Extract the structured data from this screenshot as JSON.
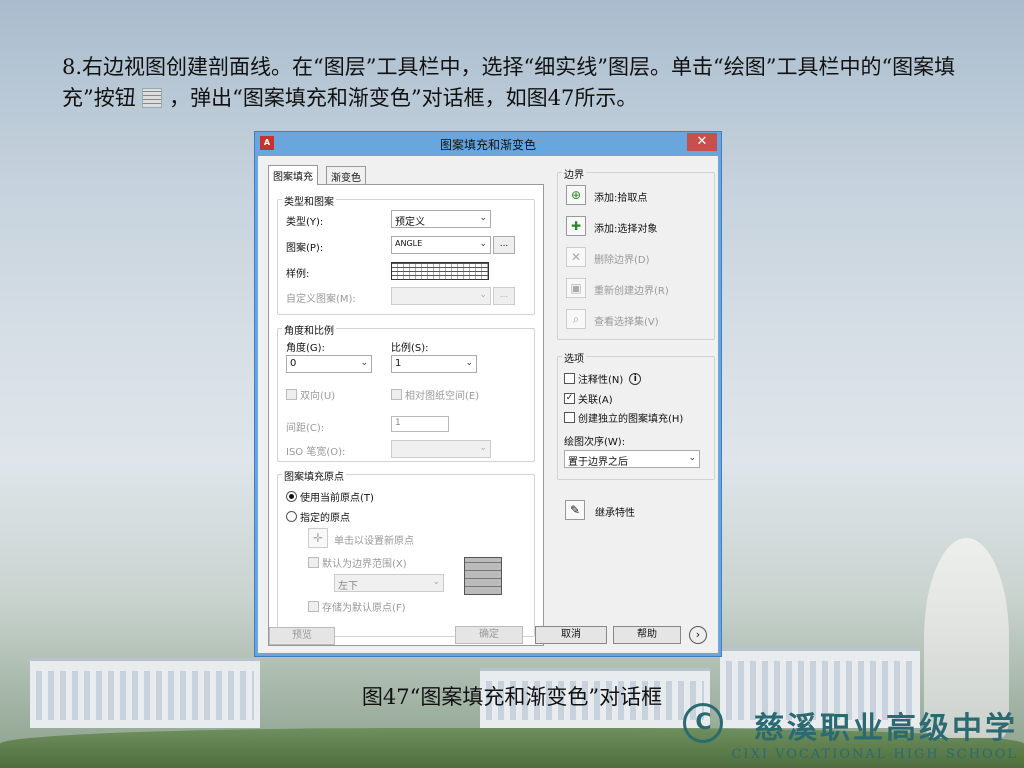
{
  "slide": {
    "para_part1": "8.右边视图创建剖面线。在“图层”工具栏中，选择“细实线”图层。单击“绘图”工具栏中的“图案填充”按钮",
    "para_part2": "，弹出“图案填充和渐变色”对话框，如图47所示。",
    "caption": "图47“图案填充和渐变色”对话框",
    "school_cn": "慈溪职业高级中学",
    "school_en": "CIXI VOCATIONAL HIGH SCHOOL",
    "school_logo": "C"
  },
  "dialog": {
    "title": "图案填充和渐变色",
    "app_icon": "A",
    "close": "✕",
    "tabs": [
      "图案填充",
      "渐变色"
    ],
    "type_pattern": {
      "title": "类型和图案",
      "type_label": "类型(Y):",
      "type_value": "预定义",
      "pattern_label": "图案(P):",
      "pattern_value": "ANGLE",
      "dots": "...",
      "swatch_label": "样例:",
      "custom_label": "自定义图案(M):"
    },
    "angle_scale": {
      "title": "角度和比例",
      "angle_label": "角度(G):",
      "angle_value": "0",
      "scale_label": "比例(S):",
      "scale_value": "1",
      "double": "双向(U)",
      "relative": "相对图纸空间(E)",
      "spacing_label": "间距(C):",
      "spacing_value": "1",
      "iso_label": "ISO 笔宽(O):"
    },
    "origin": {
      "title": "图案填充原点",
      "use_current": "使用当前原点(T)",
      "specified": "指定的原点",
      "click_set": "单击以设置新原点",
      "default_extent": "默认为边界范围(X)",
      "position": "左下",
      "store_default": "存储为默认原点(F)"
    },
    "boundary": {
      "title": "边界",
      "add_pick": "添加:拾取点",
      "add_select": "添加:选择对象",
      "remove": "删除边界(D)",
      "recreate": "重新创建边界(R)",
      "view_set": "查看选择集(V)"
    },
    "options": {
      "title": "选项",
      "annotative": "注释性(N)",
      "associative": "关联(A)",
      "separate": "创建独立的图案填充(H)",
      "draw_order_label": "绘图次序(W):",
      "draw_order_value": "置于边界之后"
    },
    "inherit": "继承特性",
    "buttons": {
      "preview": "预览",
      "ok": "确定",
      "cancel": "取消",
      "help": "帮助",
      "more": "›"
    },
    "colors": {
      "title_bar": "#69a6de",
      "close_bg": "#c7504a"
    }
  }
}
